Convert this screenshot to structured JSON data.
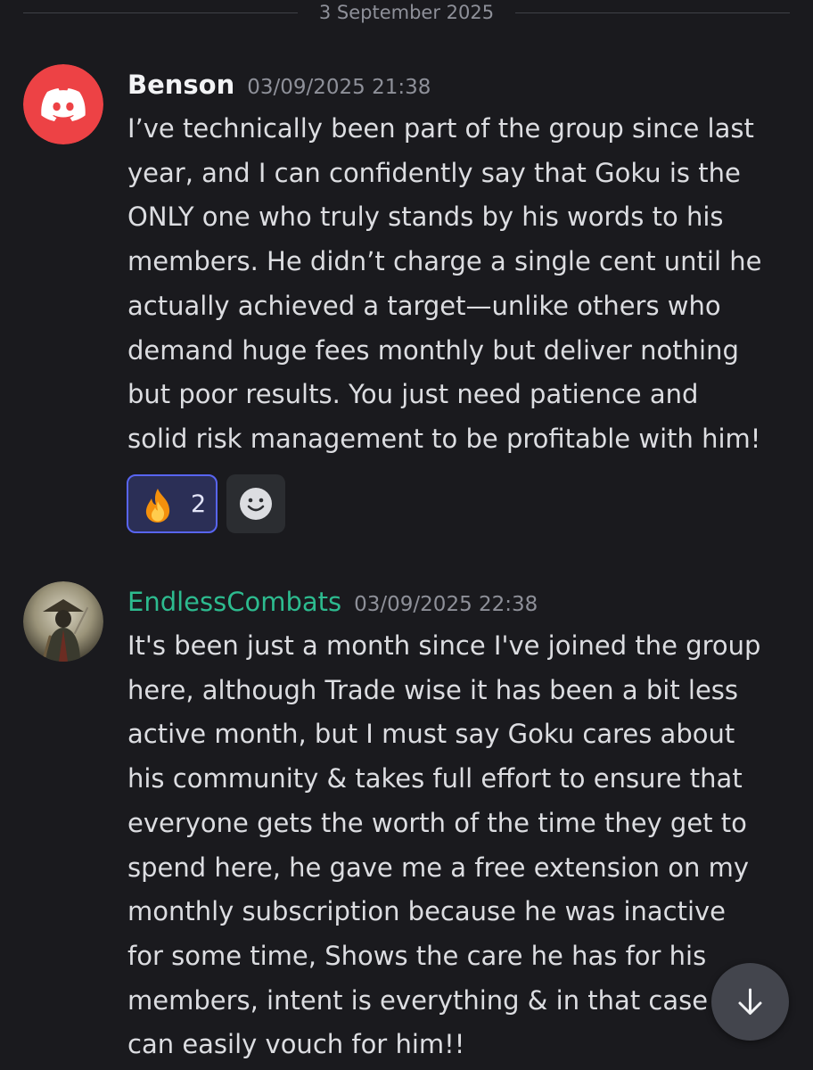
{
  "date_divider": "3 September 2025",
  "messages": [
    {
      "author": "Benson",
      "timestamp": "03/09/2025 21:38",
      "avatar_icon": "discord-logo-icon",
      "author_color": "#f2f3f5",
      "lines": [
        "I’ve technically been part of the group since last",
        "year, and I can confidently say that Goku is the",
        "ONLY one who truly stands by his words to his",
        "members. He didn’t charge a single cent until he",
        "actually achieved a target—unlike others who",
        "demand huge fees monthly but deliver nothing",
        "but poor results. You just need patience and",
        "solid risk management to be profitable with him!"
      ],
      "reactions": [
        {
          "emoji": "fire-emoji-icon",
          "count": "2",
          "reacted_by_me": true
        }
      ],
      "add_reaction_icon": "smiley-add-reaction-icon"
    },
    {
      "author": "EndlessCombats",
      "timestamp": "03/09/2025 22:38",
      "avatar_icon": "samurai-avatar-image",
      "author_color": "#2dbb8f",
      "lines": [
        "It's been just a month since I've joined the group",
        "here, although Trade wise it has been a bit less",
        "active month, but I must say Goku cares about",
        "his community & takes full effort to ensure that",
        "everyone gets the worth of the time they get to",
        "spend here, he gave me a free extension on my",
        "monthly subscription because he was inactive",
        "for some time, Shows the care he has for his",
        "members, intent is everything & in that case I",
        "can easily vouch for him!!"
      ]
    }
  ],
  "jump_to_present_icon": "arrow-down-icon",
  "colors": {
    "background": "#1a1a1e",
    "accent": "#5865f2",
    "discord_red": "#ed4245"
  }
}
